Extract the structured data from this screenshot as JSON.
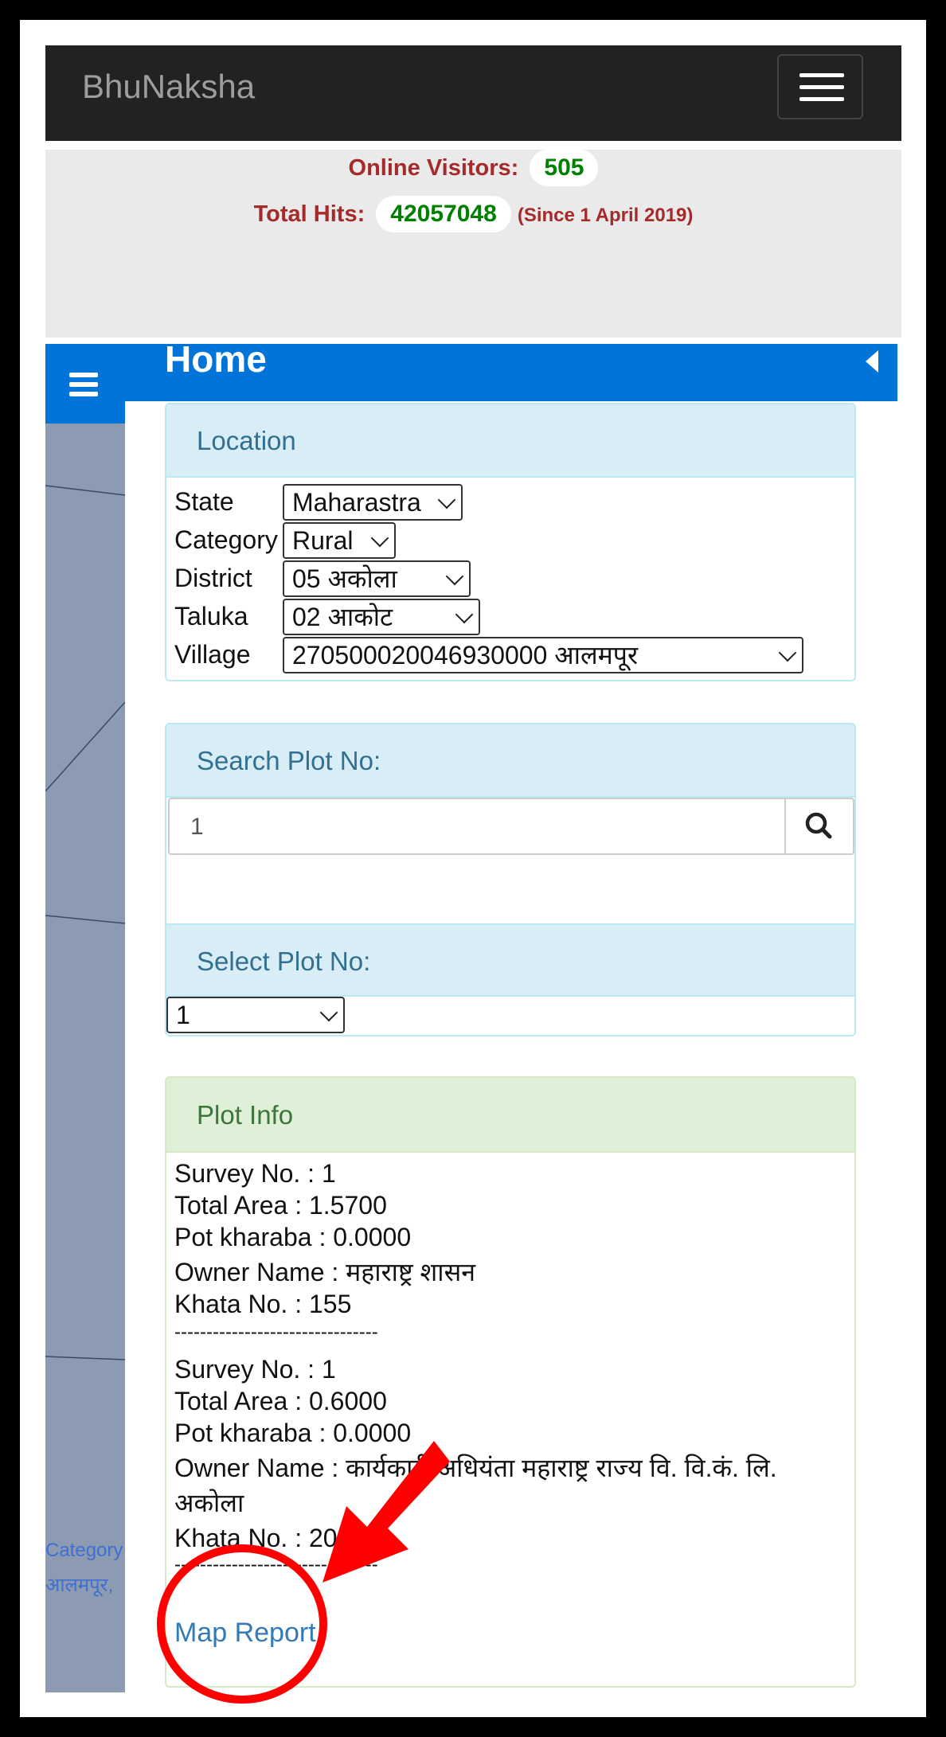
{
  "app": {
    "brand": "BhuNaksha"
  },
  "stats": {
    "online_label": "Online Visitors:",
    "online_value": "505",
    "hits_label": "Total Hits:",
    "hits_value": "42057048",
    "since": "(Since 1 April 2019)"
  },
  "header": {
    "title": "Home"
  },
  "location": {
    "heading": "Location",
    "state_label": "State",
    "state_value": "Maharastra",
    "category_label": "Category",
    "category_value": "Rural",
    "district_label": "District",
    "district_value": "05 अकोला",
    "taluka_label": "Taluka",
    "taluka_value": "02 आकोट",
    "village_label": "Village",
    "village_value": "270500020046930000 आलमपूर"
  },
  "search": {
    "heading": "Search Plot No:",
    "value": "1"
  },
  "select_plot": {
    "heading": "Select Plot No:",
    "value": "1"
  },
  "plot_info": {
    "heading": "Plot Info",
    "record1": {
      "survey": "Survey No. : 1",
      "area": "Total Area : 1.5700",
      "pot": "Pot kharaba : 0.0000",
      "owner": "Owner Name : महाराष्ट्र शासन",
      "khata": "Khata No. : 155",
      "sep": "--------------------------------"
    },
    "record2": {
      "survey": "Survey No. : 1",
      "area": "Total Area : 0.6000",
      "pot": "Pot kharaba : 0.0000",
      "owner_line1": "Owner Name : कार्यकारी अधियंता महाराष्ट्र राज्य वि. वि.कं. लि.",
      "owner_line2": "अकोला",
      "khata": "Khata No. : 20",
      "sep": "--------------------------------"
    },
    "map_report": "Map Report"
  },
  "map_labels": {
    "line1": "Category",
    "line2": "आलमपूर,"
  },
  "colors": {
    "accent": "#0074d9",
    "annotation": "#ff0000"
  }
}
